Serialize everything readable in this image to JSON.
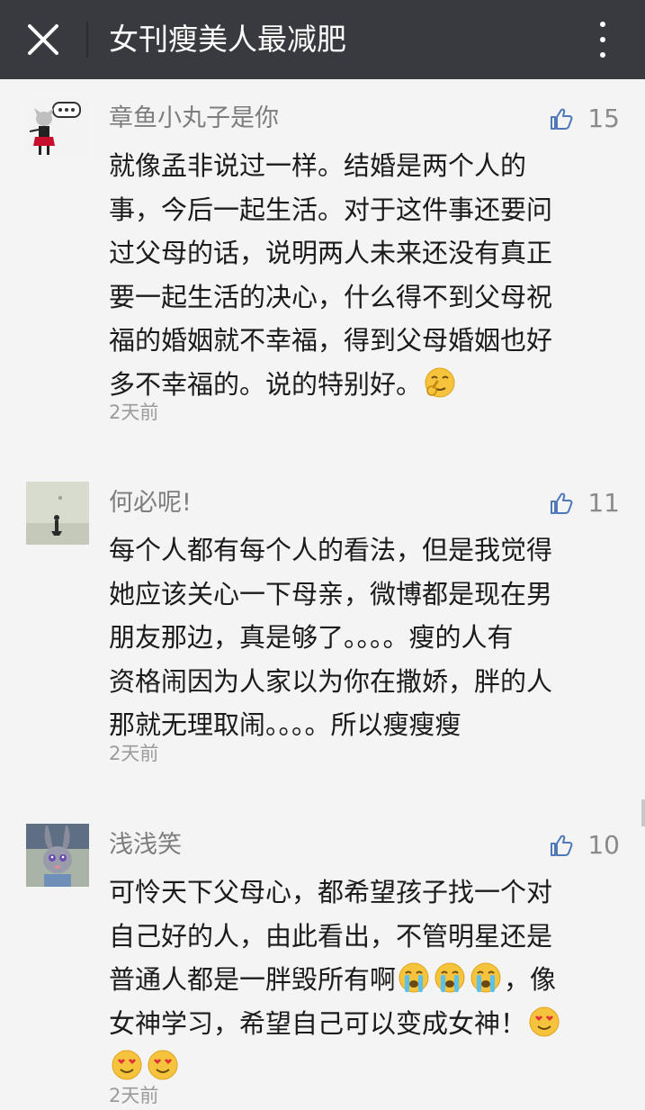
{
  "header": {
    "title": "女刊瘦美人最减肥",
    "close_icon": "close-icon",
    "more_icon": "more-vertical-icon",
    "bg_color": "#393a3f"
  },
  "comments": [
    {
      "nickname": "章鱼小丸子是你",
      "likes": "15",
      "lines": [
        "就像孟非说过一样。结婚是两个人的",
        "事，今后一起生活。对于这件事还要问",
        "过父母的话，说明两人未来还没有真正",
        "要一起生活的决心，什么得不到父母祝",
        "福的婚姻就不幸福，得到父母婚姻也好",
        "多不幸福的。说的特别好。"
      ],
      "time": "2天前",
      "emoji_icons": [
        "pick-nose-emoji-icon"
      ]
    },
    {
      "nickname": "何必呢!",
      "likes": "11",
      "lines": [
        "每个人都有每个人的看法，但是我觉得",
        "她应该关心一下母亲，微博都是现在男",
        "朋友那边，真是够了。。。。瘦的人有",
        "资格闹因为人家以为你在撒娇，胖的人",
        "那就无理取闹。。。。所以瘦瘦瘦"
      ],
      "time": "2天前"
    },
    {
      "nickname": "浅浅笑",
      "likes": "10",
      "lines": [
        "可怜天下父母心，都希望孩子找一个对",
        "自己好的人，由此看出，不管明星还是",
        "普通人都是一胖毁所有啊",
        "，像",
        "女神学习，希望自己可以变成女神！"
      ],
      "time": "2天前",
      "emoji_icons": [
        "crying-emoji-icon",
        "heart-eyes-emoji-icon"
      ]
    }
  ],
  "icons": {
    "like": "thumbs-up-icon"
  },
  "colors": {
    "like": "#4e78b8",
    "text": "#1b1b1b",
    "meta": "#9b9b9b"
  }
}
